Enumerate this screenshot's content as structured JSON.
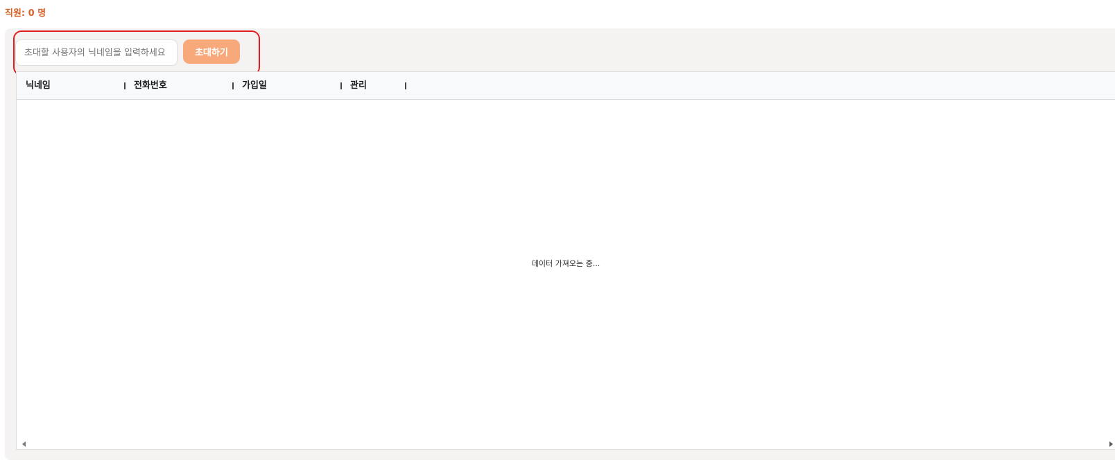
{
  "header": {
    "staff_count": "직원: 0 명"
  },
  "invite": {
    "placeholder": "초대할 사용자의 닉네임을 입력하세요",
    "value": "",
    "button_label": "초대하기"
  },
  "table": {
    "columns": [
      "닉네임",
      "전화번호",
      "가입일",
      "관리"
    ],
    "loading_text": "데이터 가져오는 중..."
  },
  "colors": {
    "accent_text": "#d9622b",
    "button_bg": "#f8a97b",
    "highlight_border": "#e01b1b"
  }
}
